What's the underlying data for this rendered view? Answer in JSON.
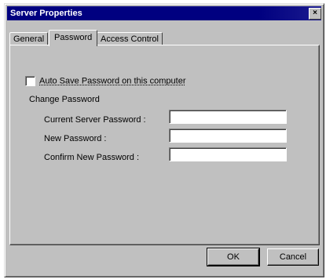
{
  "window": {
    "title": "Server Properties",
    "close_glyph": "×"
  },
  "tabs": [
    {
      "label": "General"
    },
    {
      "label": "Password"
    },
    {
      "label": "Access Control"
    }
  ],
  "password_tab": {
    "auto_save_label": "Auto Save Password on this computer",
    "auto_save_checked": false,
    "group_label": "Change Password",
    "fields": [
      {
        "label": "Current Server Password :",
        "value": ""
      },
      {
        "label": "New Password :",
        "value": ""
      },
      {
        "label": "Confirm New Password :",
        "value": ""
      }
    ]
  },
  "buttons": {
    "ok": "OK",
    "cancel": "Cancel"
  }
}
